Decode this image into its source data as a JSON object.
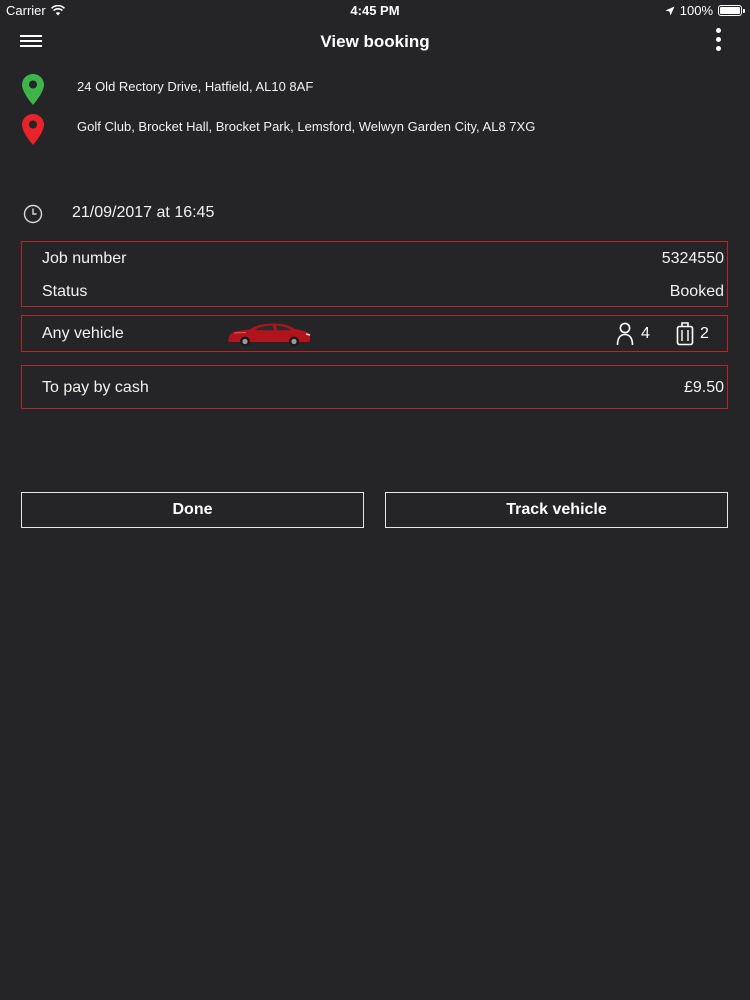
{
  "status_bar": {
    "carrier": "Carrier",
    "time": "4:45 PM",
    "battery": "100%"
  },
  "nav": {
    "title": "View booking"
  },
  "route": {
    "pickup": "24 Old Rectory Drive, Hatfield, AL10 8AF",
    "pickup_color": "#3db54a",
    "dropoff": "Golf Club, Brocket Hall, Brocket Park, Lemsford, Welwyn Garden City, AL8 7XG",
    "dropoff_color": "#e8232a"
  },
  "booking": {
    "datetime": "21/09/2017 at 16:45",
    "job_number_label": "Job number",
    "job_number": "5324550",
    "status_label": "Status",
    "status": "Booked"
  },
  "vehicle": {
    "label": "Any vehicle",
    "passengers": "4",
    "luggage": "2"
  },
  "payment": {
    "label": "To pay by cash",
    "amount": "£9.50"
  },
  "actions": {
    "done_label": "Done",
    "track_label": "Track vehicle"
  },
  "colors": {
    "background": "#252527",
    "border_accent": "#b5262b"
  }
}
